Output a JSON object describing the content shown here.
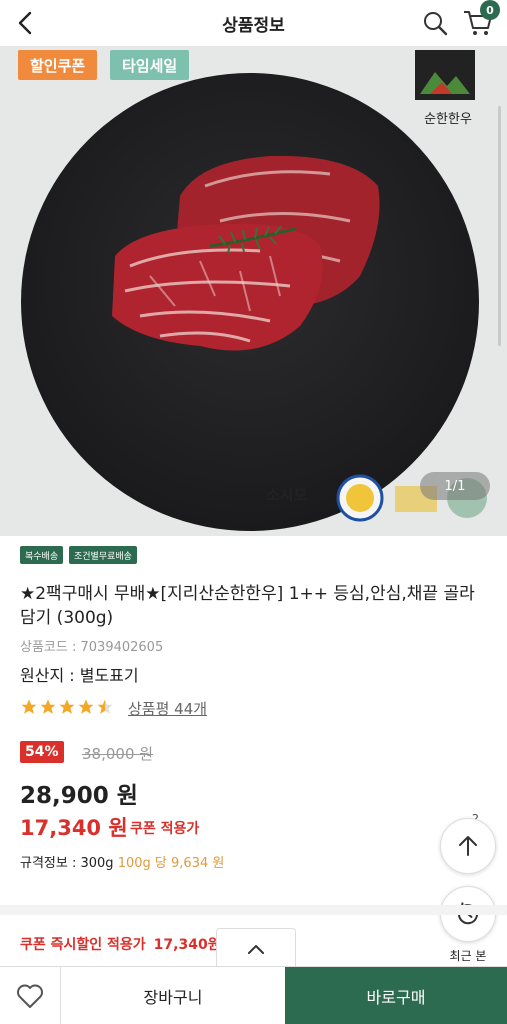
{
  "header": {
    "title": "상품정보",
    "cart_count": "0"
  },
  "hero": {
    "tags": [
      "할인쿠폰",
      "타임세일"
    ],
    "brand_label": "순한한우",
    "pager": "1/1",
    "cert_label": "소시모"
  },
  "product": {
    "chips": [
      "복수배송",
      "조건별무료배송"
    ],
    "name": "★2팩구매시 무배★[지리산순한한우] 1++ 등심,안심,채끝 골라담기 (300g)",
    "code_label": "상품코드 : ",
    "code": "7039402605",
    "origin": "원산지 : 별도표기",
    "rating": 4.5,
    "review_text": "상품평 44개",
    "discount_rate": "54%",
    "original_price": "38,000 원",
    "price": "28,900 원",
    "coupon_price": "17,340 원",
    "coupon_price_label": "쿠폰 적용가",
    "spec_label": "규격정보 : 300g",
    "spec_unit": "100g 당",
    "spec_unit_price": "9,634 원"
  },
  "float": {
    "recent_label": "최근 본",
    "top_number": "2"
  },
  "coupon_bar": {
    "text": "쿠폰 즉시할인 적용가",
    "amount": "17,340원"
  },
  "bottom": {
    "cart_label": "장바구니",
    "buy_label": "바로구매"
  },
  "colors": {
    "brand_green": "#2d6b51",
    "sale_red": "#d9302b",
    "coupon_orange": "#f08a3c",
    "timesale_teal": "#7cc0ad",
    "star": "#f5a623"
  }
}
